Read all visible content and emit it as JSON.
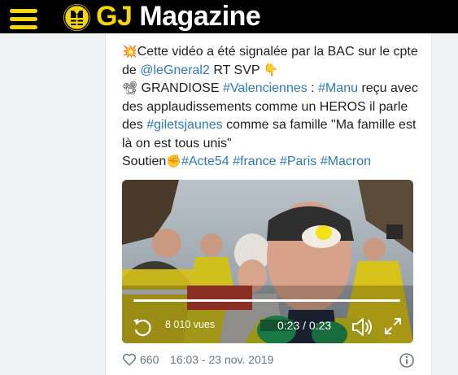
{
  "header": {
    "brand_gj": "GJ",
    "brand_name": "Magazine",
    "menu_icon": "hamburger-icon",
    "logo_icon": "yellow-vest-badge-icon",
    "accent_color": "#f5d50a"
  },
  "tweet": {
    "line1": {
      "emoji": "💥",
      "text1": "Cette vidéo a été signalée par la BAC sur le cpte de ",
      "mention": "@leGneral2",
      "text2": " RT SVP ",
      "emoji2": "👇"
    },
    "line2": {
      "emoji": "📽",
      "text1": " GRANDIOSE ",
      "tag1": "#Valenciennes",
      "text2": " : ",
      "tag2": "#Manu",
      "text3": " reçu avec des applaudissements comme un HEROS il parle des ",
      "tag3": "#giletsjaunes",
      "text4": " comme sa famille \"Ma famille est là on est tous unis\""
    },
    "line3": {
      "text1": "Soutien",
      "emoji": "✊",
      "tag1": "#Acte54",
      "tag2": "#france",
      "tag3": "#Paris",
      "tag4": "#Macron"
    },
    "link_color": "#2b7bb9"
  },
  "video": {
    "views": "8 010 vues",
    "time": "0:23 / 0:23",
    "progress": 1.0,
    "icons": [
      "replay-icon",
      "volume-icon",
      "fullscreen-icon"
    ]
  },
  "footer": {
    "likes": "660",
    "date": "16:03 - 23 nov. 2019",
    "icons": [
      "heart-icon",
      "info-icon"
    ]
  }
}
